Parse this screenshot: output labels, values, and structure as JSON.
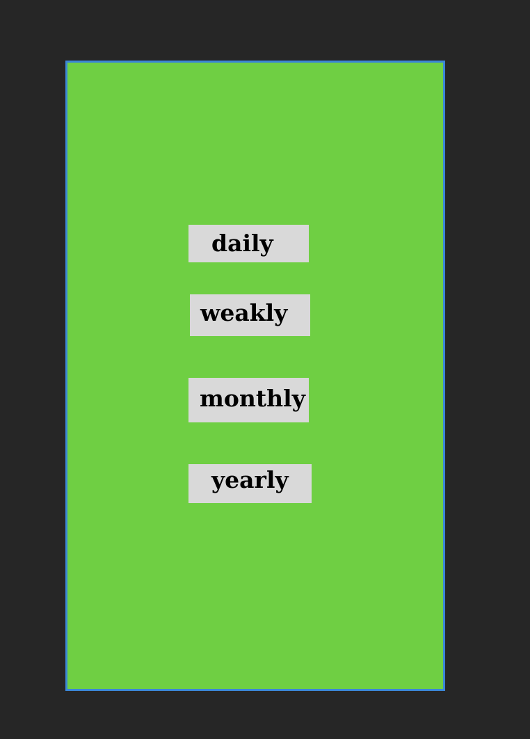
{
  "colors": {
    "background": "#262626",
    "panel_fill": "#6fcf43",
    "panel_border": "#3b86d6",
    "button_fill": "#d9d9d9",
    "button_text": "#000000"
  },
  "menu": {
    "options": [
      {
        "label": "daily"
      },
      {
        "label": "weakly"
      },
      {
        "label": "monthly"
      },
      {
        "label": "yearly"
      }
    ]
  }
}
